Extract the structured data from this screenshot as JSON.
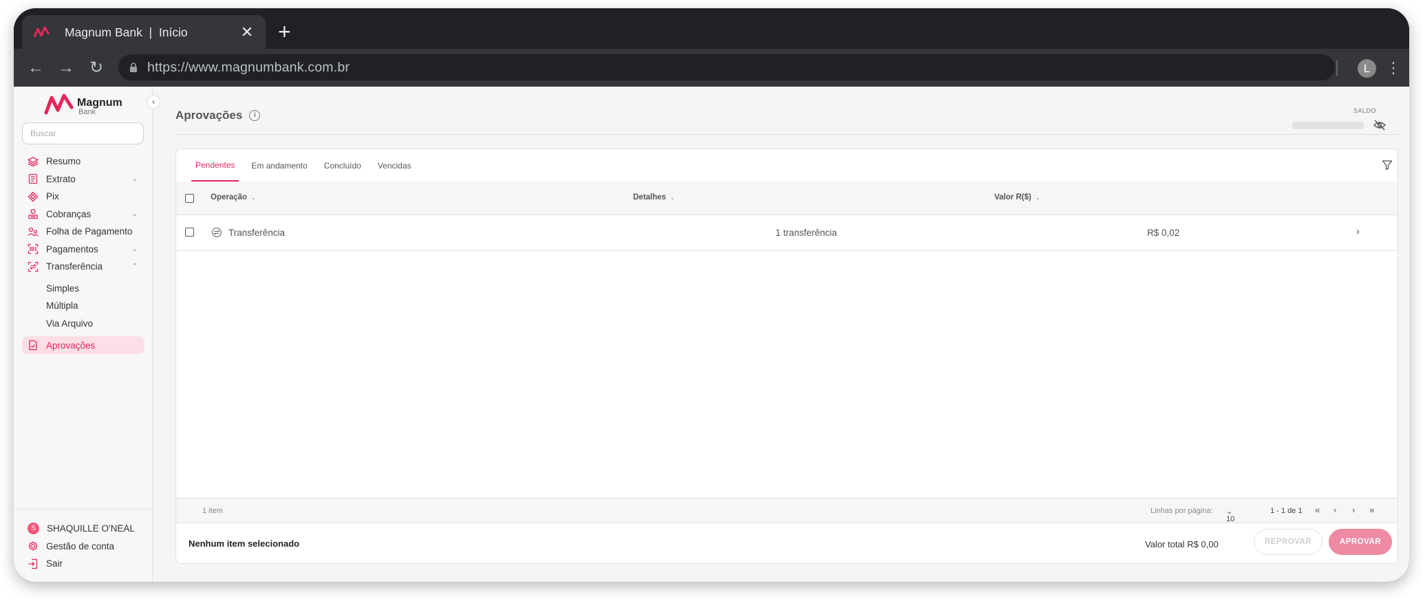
{
  "browser": {
    "tab_title": "Magnum Bank  |  Início",
    "url": "https://www.magnumbank.com.br",
    "profile_initial": "L"
  },
  "brand": {
    "name": "Magnum",
    "sub": "Bank"
  },
  "sidebar": {
    "search_placeholder": "Buscar",
    "items": [
      {
        "label": "Resumo",
        "icon": "layers-icon"
      },
      {
        "label": "Extrato",
        "icon": "statement-icon",
        "chevron": "⌄"
      },
      {
        "label": "Pix",
        "icon": "pix-icon"
      },
      {
        "label": "Cobranças",
        "icon": "charges-icon",
        "chevron": "⌄"
      },
      {
        "label": "Folha de Pagamento",
        "icon": "payroll-icon"
      },
      {
        "label": "Pagamentos",
        "icon": "payments-icon",
        "chevron": "⌄"
      },
      {
        "label": "Transferência",
        "icon": "transfer-icon",
        "chevron": "⌃"
      }
    ],
    "subitems": [
      "Simples",
      "Múltipla",
      "Via Arquivo"
    ],
    "active_item": {
      "label": "Aprovações",
      "icon": "approvals-icon"
    },
    "footer": {
      "user_initial": "S",
      "user_name": "SHAQUILLE O'NEAL",
      "account": "Gestão de conta",
      "logout": "Sair"
    }
  },
  "page": {
    "title": "Aprovações",
    "saldo_label": "SALDO"
  },
  "tabs": [
    "Pendentes",
    "Em andamento",
    "Concluído",
    "Vencidas"
  ],
  "active_tab": "Pendentes",
  "table": {
    "columns": [
      "Operação",
      "Detalhes",
      "Valor R($)"
    ],
    "rows": [
      {
        "operation": "Transferência",
        "details": "1 transferência",
        "value": "R$ 0,02"
      }
    ]
  },
  "pager": {
    "count": "1 item",
    "rows_per_page_label": "Linhas por página:",
    "rows_per_page": "10",
    "range": "1 - 1 de 1"
  },
  "actions": {
    "selection": "Nenhum item selecionado",
    "total": "Valor total R$ 0,00",
    "reject": "REPROVAR",
    "approve": "APROVAR"
  },
  "colors": {
    "accent": "#e8245a",
    "approve_bg": "#ee8aa3"
  }
}
